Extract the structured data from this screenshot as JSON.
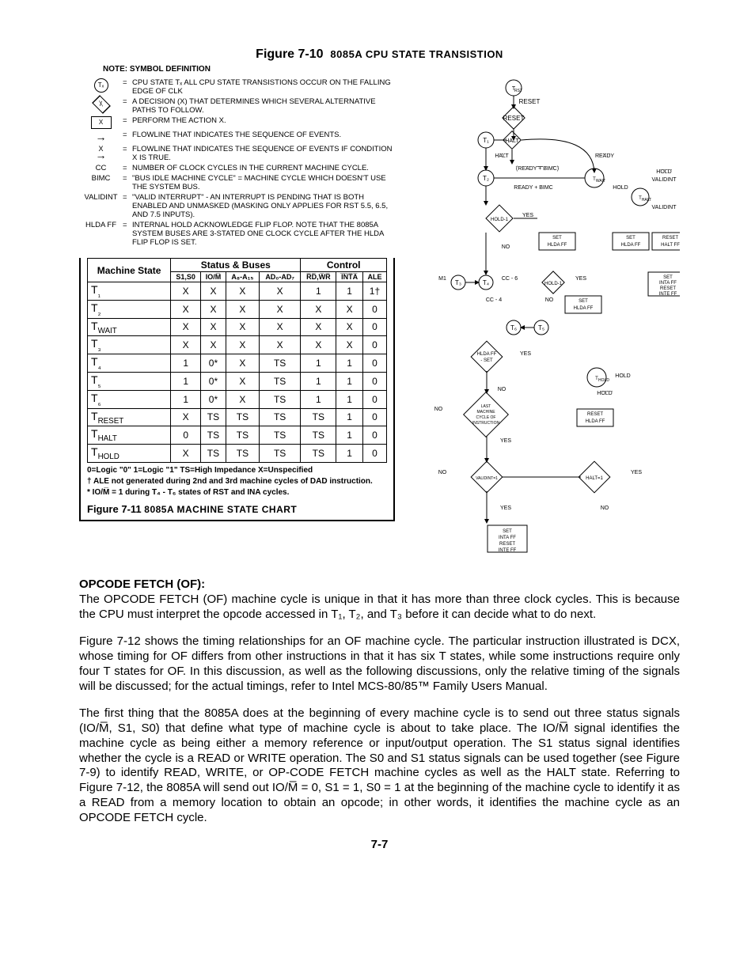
{
  "figure10": {
    "label": "Figure 7-10",
    "title": "8085A CPU STATE TRANSISTION"
  },
  "note_heading": "NOTE:  SYMBOL DEFINITION",
  "legend": [
    {
      "sym_type": "circle",
      "sym_text": "Tₓ",
      "def": "CPU STATE Tₓ  ALL CPU STATE TRANSISTIONS OCCUR ON THE FALLING EDGE OF CLK"
    },
    {
      "sym_type": "diamond",
      "sym_text": "X",
      "def": "A DECISION (X) THAT DETERMINES WHICH SEVERAL ALTERNATIVE PATHS TO FOLLOW."
    },
    {
      "sym_type": "box",
      "sym_text": "X",
      "def": "PERFORM THE ACTION X."
    },
    {
      "sym_type": "arrow",
      "sym_text": "",
      "def": "FLOWLINE THAT INDICATES THE SEQUENCE OF EVENTS."
    },
    {
      "sym_type": "arrow-x",
      "sym_text": "X",
      "def": "FLOWLINE THAT INDICATES THE SEQUENCE OF EVENTS IF CONDITION X IS TRUE."
    },
    {
      "sym_type": "text",
      "sym_text": "CC",
      "def": "NUMBER OF CLOCK CYCLES IN THE CURRENT MACHINE CYCLE."
    },
    {
      "sym_type": "text",
      "sym_text": "BIMC",
      "def": "\"BUS IDLE MACHINE CYCLE\" = MACHINE CYCLE WHICH DOESN'T USE THE SYSTEM BUS."
    },
    {
      "sym_type": "text",
      "sym_text": "VALIDINT",
      "def": "\"VALID INTERRUPT\" - AN INTERRUPT IS PENDING THAT IS BOTH ENABLED AND UNMASKED (MASKING ONLY APPLIES FOR RST 5.5, 6.5, AND 7.5 INPUTS)."
    },
    {
      "sym_type": "text",
      "sym_text": "HLDA FF",
      "def": "INTERNAL HOLD ACKNOWLEDGE FLIP FLOP. NOTE THAT THE 8085A SYSTEM BUSES ARE 3-STATED ONE CLOCK CYCLE AFTER THE HLDA FLIP FLOP IS SET."
    }
  ],
  "table": {
    "col_machine": "Machine State",
    "group_status": "Status & Buses",
    "group_control": "Control",
    "headers": [
      "S1,S0",
      "IO/M̅",
      "A₈-A₁₅",
      "AD₀-AD₇",
      "R̅D̅,W̅R̅",
      "I̅N̅T̅A̅",
      "ALE"
    ],
    "rows": [
      {
        "state": "T₁",
        "cells": [
          "X",
          "X",
          "X",
          "X",
          "1",
          "1",
          "1†"
        ]
      },
      {
        "state": "T₂",
        "cells": [
          "X",
          "X",
          "X",
          "X",
          "X",
          "X",
          "0"
        ]
      },
      {
        "state": "T_WAIT",
        "cells": [
          "X",
          "X",
          "X",
          "X",
          "X",
          "X",
          "0"
        ]
      },
      {
        "state": "T₃",
        "cells": [
          "X",
          "X",
          "X",
          "X",
          "X",
          "X",
          "0"
        ]
      },
      {
        "state": "T₄",
        "cells": [
          "1",
          "0*",
          "X",
          "TS",
          "1",
          "1",
          "0"
        ]
      },
      {
        "state": "T₅",
        "cells": [
          "1",
          "0*",
          "X",
          "TS",
          "1",
          "1",
          "0"
        ]
      },
      {
        "state": "T₆",
        "cells": [
          "1",
          "0*",
          "X",
          "TS",
          "1",
          "1",
          "0"
        ]
      },
      {
        "state": "T_RESET",
        "cells": [
          "X",
          "TS",
          "TS",
          "TS",
          "TS",
          "1",
          "0"
        ]
      },
      {
        "state": "T_HALT",
        "cells": [
          "0",
          "TS",
          "TS",
          "TS",
          "TS",
          "1",
          "0"
        ]
      },
      {
        "state": "T_HOLD",
        "cells": [
          "X",
          "TS",
          "TS",
          "TS",
          "TS",
          "1",
          "0"
        ]
      }
    ],
    "note_legend": "0=Logic \"0\"   1=Logic \"1\"   TS=High Impedance   X=Unspecified",
    "note_dagger": "† ALE not generated during 2nd and 3rd machine cycles of DAD instruction.",
    "note_star": "* IO/M̅ = 1 during T₄ - T₆ states of RST and INA cycles."
  },
  "figure11": {
    "label": "Figure 7-11",
    "title": "8085A MACHINE STATE CHART"
  },
  "flowchart_labels": [
    "T_RESET",
    "RESET",
    "RESET",
    "T₁",
    "HALT",
    "HALT",
    "READY",
    "T₂",
    "(READY + BIMC)",
    "T_WAIT",
    "HOLD VALIDINT",
    "READY + BIMC",
    "HOLD",
    "T_HALT",
    "VALIDINT",
    "HOLD - 1",
    "YES",
    "SET HLDA FF",
    "RESET HALT FF",
    "NO",
    "SET HLDA FF",
    "M1",
    "T₃",
    "T₄",
    "CC - 6",
    "HOLD - 1",
    "YES",
    "SET INTA FF RESET INTE FF",
    "CC - 4",
    "NO",
    "SET HLDA FF",
    "T₆",
    "T₅",
    "HLDA FF - SET",
    "YES",
    "T_HOLD",
    "HOLD",
    "NO",
    "HOLD",
    "LAST MACHINE CYCLE OF INSTRUCTION",
    "RESET HLDA FF",
    "YES",
    "NO",
    "VALIDINT = 1",
    "HALT = 1",
    "YES",
    "YES",
    "NO",
    "SET INTA FF RESET INTE FF"
  ],
  "body": {
    "h1": "OPCODE FETCH (OF):",
    "p1": "The OPCODE FETCH (OF) machine cycle is unique in that it has more than three clock cycles. This is because the CPU must interpret the opcode accessed in T₁, T₂, and T₃ before it can decide what to do next.",
    "p2": "Figure 7-12 shows the timing relationships for an OF machine cycle.  The particular instruction illustrated is DCX, whose timing for OF differs from other instructions in that it has six T states, while some instructions require only four T states for OF.  In this discussion, as well as the following discussions, only the relative timing of the signals will be discussed; for the actual timings, refer to Intel MCS-80/85™ Family Users Manual.",
    "p3": "The first thing that the 8085A does at the beginning of every machine cycle is to send out three status signals (IO/M̅, S1, S0) that define what type of machine cycle is about to take place.  The IO/M̅ signal identifies the machine cycle as being either a memory reference or input/output operation.  The S1 status signal identifies whether the cycle is a READ or WRITE operation.  The S0 and S1 status signals can be used together (see Figure 7-9) to identify READ, WRITE, or OP-CODE FETCH machine cycles as well as the HALT state.  Referring to Figure 7-12, the 8085A will send out IO/M̅ = 0, S1 = 1, S0 = 1 at the beginning of the machine cycle to identify it as a READ from a memory location to obtain an opcode; in other words, it identifies the machine cycle as an OPCODE FETCH cycle."
  },
  "page_number": "7-7"
}
